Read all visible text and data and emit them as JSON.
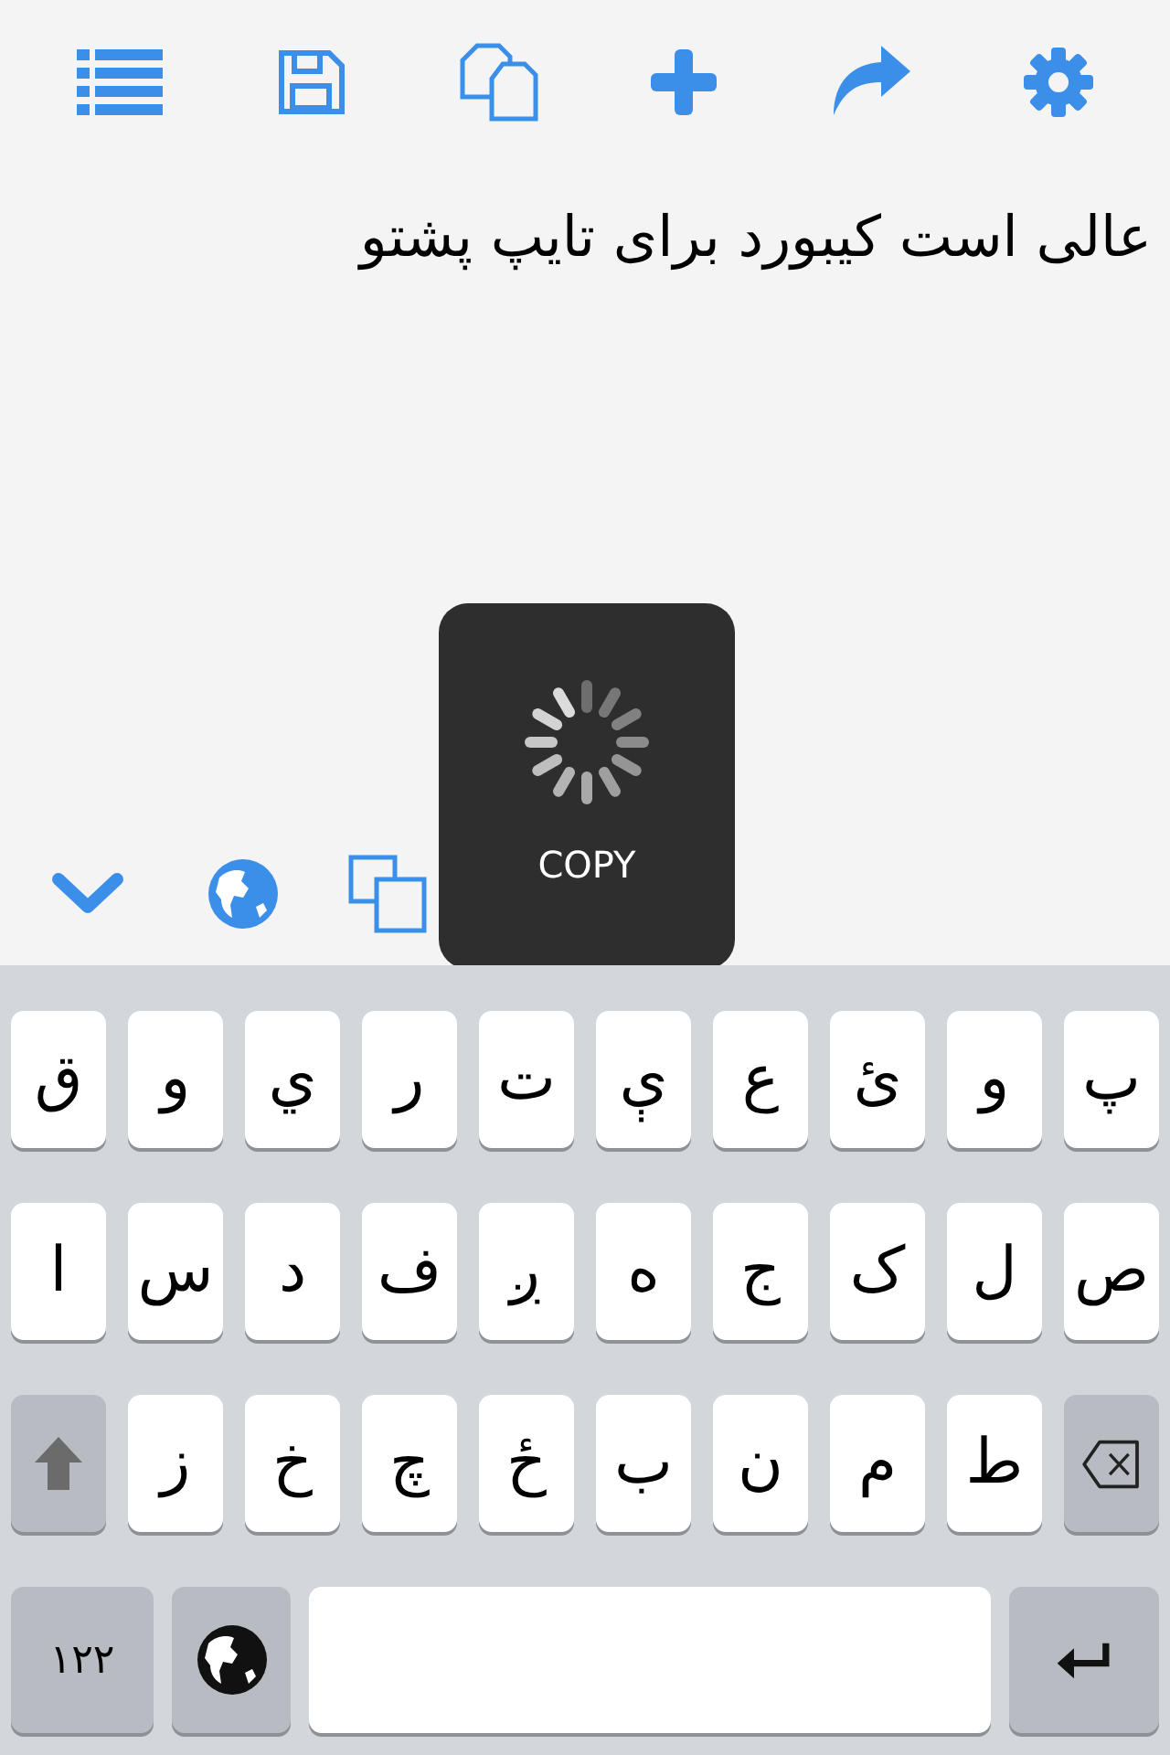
{
  "editor": {
    "text": "عالی است کیبورد برای تایپ پشتو"
  },
  "hud": {
    "label": "COPY"
  },
  "keyboard": {
    "rows": [
      [
        {
          "kind": "letter",
          "label": "پ"
        },
        {
          "kind": "letter",
          "label": "و"
        },
        {
          "kind": "letter",
          "label": "ئ"
        },
        {
          "kind": "letter",
          "label": "ع"
        },
        {
          "kind": "letter",
          "label": "ې"
        },
        {
          "kind": "letter",
          "label": "ت"
        },
        {
          "kind": "letter",
          "label": "ر"
        },
        {
          "kind": "letter",
          "label": "ي"
        },
        {
          "kind": "letter",
          "label": "و"
        },
        {
          "kind": "letter",
          "label": "ق"
        }
      ],
      [
        {
          "kind": "letter",
          "label": "ص"
        },
        {
          "kind": "letter",
          "label": "ل"
        },
        {
          "kind": "letter",
          "label": "ک"
        },
        {
          "kind": "letter",
          "label": "ج"
        },
        {
          "kind": "letter",
          "label": "ه"
        },
        {
          "kind": "letter",
          "label": "ږ"
        },
        {
          "kind": "letter",
          "label": "ف"
        },
        {
          "kind": "letter",
          "label": "د"
        },
        {
          "kind": "letter",
          "label": "س"
        },
        {
          "kind": "letter",
          "label": "ا"
        }
      ],
      [
        {
          "kind": "backspace"
        },
        {
          "kind": "letter",
          "label": "ط"
        },
        {
          "kind": "letter",
          "label": "م"
        },
        {
          "kind": "letter",
          "label": "ن"
        },
        {
          "kind": "letter",
          "label": "ب"
        },
        {
          "kind": "letter",
          "label": "ځ"
        },
        {
          "kind": "letter",
          "label": "چ"
        },
        {
          "kind": "letter",
          "label": "خ"
        },
        {
          "kind": "letter",
          "label": "ز"
        },
        {
          "kind": "shift"
        }
      ],
      [
        {
          "kind": "return"
        },
        {
          "kind": "space"
        },
        {
          "kind": "globe"
        },
        {
          "kind": "numbers",
          "label": "١٢٢"
        }
      ]
    ]
  }
}
